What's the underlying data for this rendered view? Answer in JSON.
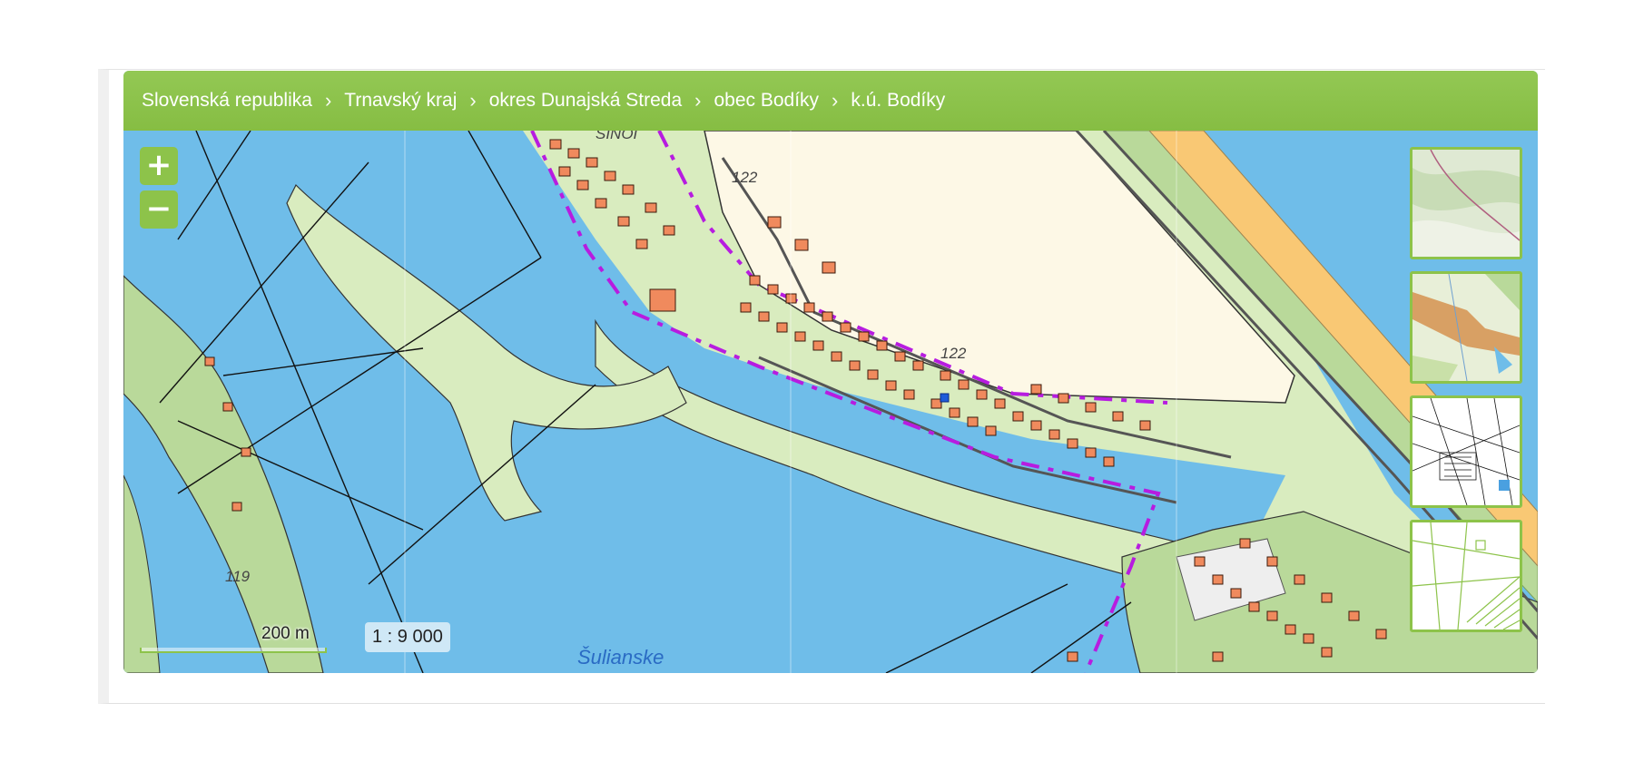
{
  "breadcrumb": {
    "items": [
      "Slovenská republika",
      "Trnavský kraj",
      "okres Dunajská Streda",
      "obec Bodíky",
      "k.ú. Bodíky"
    ],
    "separator": "›"
  },
  "zoom": {
    "in_label": "+",
    "out_label": "−"
  },
  "scale": {
    "distance": "200 m",
    "ratio": "1 : 9 000"
  },
  "map_labels": {
    "water_name": "Šulianske",
    "top_label": "SINOI",
    "elevation_1": "122",
    "elevation_2": "122",
    "elevation_3": "119"
  },
  "layer_switcher": [
    {
      "id": "terrain"
    },
    {
      "id": "ortho"
    },
    {
      "id": "cadastre"
    },
    {
      "id": "parcels"
    }
  ],
  "colors": {
    "accent": "#8dc34a",
    "water": "#6fbde9",
    "meadow": "#d9ecbf",
    "road": "#f9c874",
    "boundary": "#b71ce0",
    "building": "#f08a5d"
  }
}
